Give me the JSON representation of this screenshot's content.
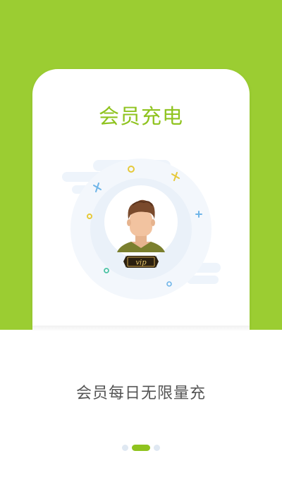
{
  "hero": {
    "title": "会员充电",
    "illustration": "vip-member-avatar",
    "badge_text": "VIP"
  },
  "caption": "会员每日无限量充",
  "pager": {
    "total": 3,
    "active_index": 1
  },
  "colors": {
    "brand_green": "#9bcd32",
    "title_green": "#8fc31f",
    "caption_gray": "#555555",
    "dot_inactive": "#dfe8f2"
  }
}
